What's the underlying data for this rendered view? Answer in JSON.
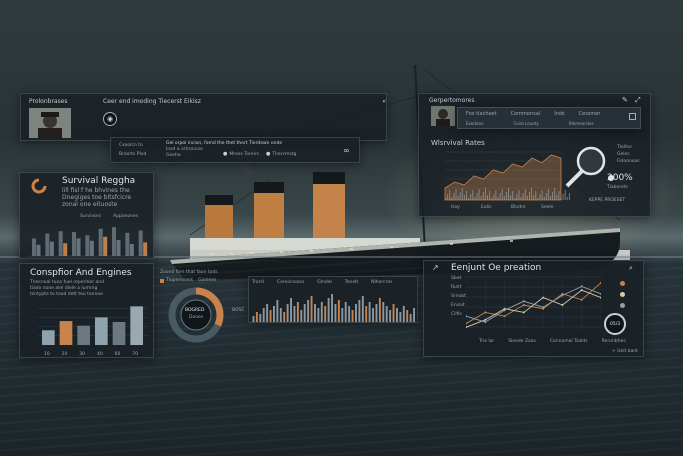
{
  "header": {
    "profile_label": "Prolonbrases",
    "title": "Ceer end imoding Tiecerst Eikisz"
  },
  "info_bar": {
    "left_a": "Cxoolcn to",
    "left_b": "Broorts Plod",
    "mid_a": "Gel orpol incion, fomd the thet thort Tierdown onde",
    "mid_b": "Insd a ortroncoo",
    "mid_c": "Geeha",
    "btn_a": "Mrees Toreirs",
    "btn_b": "Thercmstg"
  },
  "survival_panel": {
    "title": "Survival Reggha",
    "lines": [
      "lill fisl f he bhvines the",
      "Dnegiges toe bltsfcicre",
      "zonal one eituoste"
    ],
    "legend": [
      "Survivors",
      "Apponones"
    ],
    "chart_data": {
      "type": "bar",
      "series": [
        {
          "name": "Survivors",
          "values": [
            2.2,
            2.8,
            3.1,
            3.0,
            2.6,
            3.4,
            3.6,
            2.9,
            3.2
          ]
        },
        {
          "name": "Apponones",
          "values": [
            1.4,
            1.8,
            1.6,
            2.2,
            1.9,
            2.4,
            2.0,
            1.5,
            1.7
          ]
        }
      ],
      "ylim": [
        0,
        4
      ]
    }
  },
  "config_panel": {
    "title": "Conspfior And Engines",
    "lines": [
      "Tnecnoal tuoa fuel reperlner and",
      "tiadx none alel diele a lumrng",
      "tzntypte to tood dett teu tannoe"
    ],
    "chart_data": {
      "type": "bar",
      "categories": [
        "10",
        "20",
        "30",
        "40",
        "60",
        "70"
      ],
      "values": [
        1.6,
        2.6,
        2.1,
        3.0,
        2.5,
        4.2
      ],
      "ylim": [
        0,
        5
      ]
    }
  },
  "donut_widget": {
    "header": "Zoond fom that faon tods",
    "legend_a": "Tlopenooels",
    "legend_b": "Ganlees",
    "center_label": "BOGRED",
    "center_sub": "Dooes",
    "side_label": "BOSE",
    "chart_data": {
      "type": "pie",
      "values": [
        32,
        68
      ],
      "colors": [
        "#c8834c",
        "#4a5a62"
      ]
    }
  },
  "histogram_panel": {
    "headers": [
      "Trorsl",
      "Cereicnooss",
      "Glndel",
      "Tenelt",
      "Nlhercres"
    ],
    "chart_data": {
      "type": "bar",
      "values": [
        3,
        5,
        4,
        7,
        9,
        6,
        8,
        11,
        7,
        5,
        9,
        12,
        8,
        10,
        6,
        9,
        11,
        13,
        9,
        7,
        10,
        8,
        12,
        14,
        9,
        11,
        7,
        10,
        8,
        6,
        9,
        11,
        13,
        8,
        10,
        7,
        9,
        12,
        10,
        8,
        6,
        9,
        7,
        5,
        8,
        6,
        4,
        7
      ],
      "ylim": [
        0,
        16
      ]
    }
  },
  "rates_panel": {
    "header": "Gerpertomores",
    "menu": [
      "Fox tlacheet",
      "Commonsal",
      "Inds",
      "Cessmer"
    ],
    "submenu": [
      "Exerbion",
      "Coiro Louety",
      "Rfemeorsles"
    ],
    "title": "Wlsrvival Rates",
    "percent": "200%",
    "button": "KEPPE PROESET",
    "labels": [
      "Tlelitsr",
      "Gelec",
      "Fidoonoas",
      "Tiaborets"
    ],
    "ticks": [
      "Hay",
      "Ealis",
      "Blodre",
      "Seele"
    ],
    "chart_data": {
      "type": "area",
      "values": [
        2,
        3,
        2.5,
        4,
        3.5,
        5,
        4.5,
        6,
        5.5,
        7,
        6.2,
        7.5,
        7.0
      ],
      "ylim": [
        0,
        8
      ]
    }
  },
  "exploration_panel": {
    "title": "Eenjunt Oe preation",
    "ylabels": [
      "Sbet",
      "Rulrt",
      "Srnobt",
      "Ensoit",
      "Cilfis"
    ],
    "xlabels": [
      "Trie lar",
      "Sleede Zoos",
      "Connomal Tsalds",
      "Rerunbhes"
    ],
    "footer": "+ Ueit bant",
    "knob": "05/3",
    "chart_data": {
      "type": "line",
      "series": [
        {
          "values": [
            1,
            2.5,
            2.0,
            3.5,
            3.0,
            5.0,
            4.2,
            6.5
          ]
        },
        {
          "values": [
            0.5,
            1.5,
            3.0,
            2.5,
            4.5,
            3.5,
            5.5,
            4.5
          ]
        },
        {
          "values": [
            2.0,
            1.2,
            2.8,
            4.0,
            3.2,
            4.8,
            6.0,
            5.0
          ]
        }
      ],
      "ylim": [
        0,
        7
      ]
    }
  }
}
